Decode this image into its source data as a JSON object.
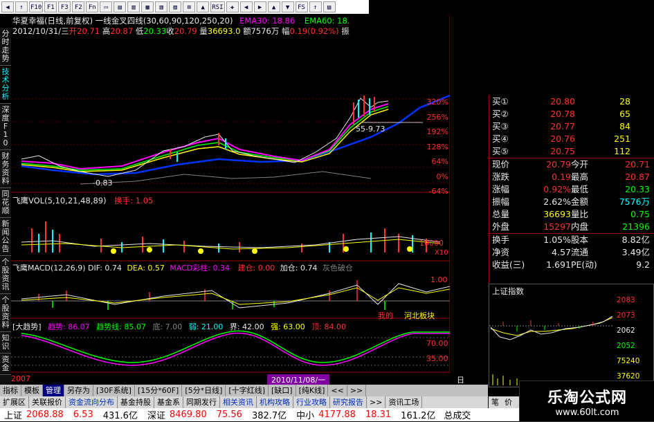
{
  "toolbar": {
    "buttons": [
      "◀",
      "↑",
      "F10",
      "F1",
      "F3",
      "F2",
      "Fn",
      "▭",
      "▤",
      "▥",
      "▦",
      "▧",
      "▨",
      "⊞",
      "▲",
      "RSI",
      "✚",
      "◀",
      "▶",
      "▲",
      "▼",
      "FS",
      "↑",
      "▤"
    ]
  },
  "vtabs": {
    "items": [
      "分时走势",
      "技术分析",
      "深度F10",
      "财务资料",
      "同花顺",
      "新闻公告",
      "个股资讯",
      "个股资料",
      "知识",
      "资金"
    ]
  },
  "header": {
    "line1": [
      "华夏幸福(日线,前复权) 一线金叉四线(30,60,90,120,250,20)",
      "EMA30: 18.86",
      "EMA60: 18."
    ],
    "date": "2012/10/31/三",
    "open_label": "开",
    "open": "20.71",
    "high_label": "高",
    "high": "20.87",
    "low_label": "低",
    "low": "20.33",
    "close_label": "收",
    "close": "20.79",
    "vol_label": "量",
    "vol": "36693.0",
    "amt_label": "额",
    "amt": "7576万",
    "chg_label": "幅",
    "chg": "0.19(0.92%)",
    "trail": "振"
  },
  "main_chart": {
    "pct_axis": [
      "320%",
      "256%",
      "192%",
      "128%",
      "64%",
      "0%",
      "-64%"
    ],
    "low_label": "-0.83",
    "high_label": "55-9.73"
  },
  "vol_panel": {
    "title": "飞鹰VOL(5,10,21,48,89)",
    "turnover_label": "换手:",
    "turnover": "1.05",
    "axis": [
      "10000",
      "X10"
    ]
  },
  "macd_panel": {
    "title": "飞鹰MACD(12,26,9)",
    "dif": "DIF: 0.74",
    "dea": "DEA: 0.57",
    "macd": "MACD彩柱: 0.34",
    "jiancang": "建仓: 0.00",
    "jiacang": "加仓: 0.74",
    "huise": "灰色破仓",
    "axis": [
      "1.00"
    ],
    "labels": [
      "我的",
      "河北板块"
    ]
  },
  "trend_panel": {
    "title": "[大趋势]",
    "trend": "趋势: 86.07",
    "trend_line": "趋势线: 85.07",
    "di": "底: 7.00",
    "ruo": "弱: 21.00",
    "jie": "界: 42.00",
    "qiang": "强: 63.00",
    "ding": "顶: 84.00",
    "axis": [
      "70.00",
      "35.00"
    ]
  },
  "date_strip": {
    "left": "2007",
    "center": "2010/11/08/一",
    "right": "日线"
  },
  "quotes": {
    "bids": [
      {
        "label": "买①",
        "price": "20.80",
        "vol": "28"
      },
      {
        "label": "买②",
        "price": "20.78",
        "vol": "65"
      },
      {
        "label": "买③",
        "price": "20.77",
        "vol": "84"
      },
      {
        "label": "买④",
        "price": "20.76",
        "vol": "251"
      },
      {
        "label": "买⑤",
        "price": "20.75",
        "vol": "112"
      }
    ],
    "stats": [
      {
        "l1": "现价",
        "v1": "20.79",
        "l2": "今开",
        "v2": "20.71",
        "c1": "#ff3030",
        "c2": "#ff3030"
      },
      {
        "l1": "涨跌",
        "v1": "0.19",
        "l2": "最高",
        "v2": "20.87",
        "c1": "#ff3030",
        "c2": "#ff3030"
      },
      {
        "l1": "涨幅",
        "v1": "0.92%",
        "l2": "最低",
        "v2": "20.33",
        "c1": "#ff3030",
        "c2": "#00ff00"
      },
      {
        "l1": "振幅",
        "v1": "2.62%",
        "l2": "金额",
        "v2": "7576万",
        "c1": "#e8e8e8",
        "c2": "#00ffff"
      },
      {
        "l1": "总量",
        "v1": "36693",
        "l2": "量比",
        "v2": "0.75",
        "c1": "#ffff00",
        "c2": "#00ff00"
      },
      {
        "l1": "外盘",
        "v1": "15297",
        "l2": "内盘",
        "v2": "21396",
        "c1": "#ff3030",
        "c2": "#00ff00"
      },
      {
        "l1": "换手",
        "v1": "1.05%",
        "l2": "股本",
        "v2": "8.82亿",
        "c1": "#e8e8e8",
        "c2": "#e8e8e8"
      },
      {
        "l1": "净资",
        "v1": "4.57",
        "l2": "流通",
        "v2": "3.49亿",
        "c1": "#e8e8e8",
        "c2": "#e8e8e8"
      },
      {
        "l1": "收益(三)",
        "v1": "1.691",
        "l2": "PE(动)",
        "v2": "9.2",
        "c1": "#e8e8e8",
        "c2": "#e8e8e8"
      }
    ]
  },
  "mini_chart": {
    "title": "上证指数",
    "axis": [
      "2083",
      "2073",
      "2062",
      "2052",
      "75240",
      "37620"
    ]
  },
  "bottom_tabs1": [
    "指标",
    "模板",
    "管理",
    "另存为",
    "[30F系统]",
    "[15分*60F]",
    "[5分*日线]",
    "[十字红线]",
    "[缺口]",
    "[纯K线]",
    "<<",
    ">>"
  ],
  "bottom_tabs2": [
    "扩展区",
    "关联报价",
    "资金流向分布",
    "基金持股",
    "基金系",
    "同期发行",
    "相关资讯",
    "机构攻略",
    "行业攻略",
    "研究报告",
    ">>",
    "资讯工场"
  ],
  "ticker": [
    {
      "name": "上证",
      "price": "2068.88",
      "chg": "6.53",
      "amt": "431.6亿"
    },
    {
      "name": "深证",
      "price": "8469.80",
      "chg": "75.56",
      "amt": "382.7亿"
    },
    {
      "name": "中小",
      "price": "4177.88",
      "chg": "18.31",
      "amt": "161.2亿"
    }
  ],
  "ticker_tail": "总成交",
  "watermark": {
    "title": "乐淘公式网",
    "url": "www.60lt.com"
  },
  "side_tail": [
    "笔",
    "价"
  ]
}
